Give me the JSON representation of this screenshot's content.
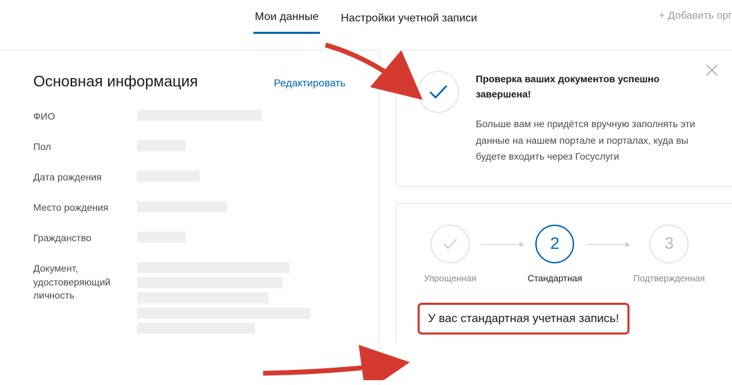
{
  "tabs": {
    "my_data": "Мои данные",
    "account_settings": "Настройки учетной записи",
    "add_org": "+ Добавить орг"
  },
  "basic_info": {
    "title": "Основная информация",
    "edit": "Редактировать",
    "fields": {
      "fio": "ФИО",
      "gender": "Пол",
      "birth_date": "Дата рождения",
      "birth_place": "Место рождения",
      "citizenship": "Гражданство",
      "id_document": "Документ, удостоверяющий личность"
    }
  },
  "notice": {
    "title": "Проверка ваших документов успешно завершена!",
    "description": "Больше вам не придётся вручную заполнять эти данные на нашем портале и порталах, куда вы будете входить через Госуслуги"
  },
  "account_status": {
    "steps": {
      "simplified": "Упрощенная",
      "standard": "Стандартная",
      "confirmed": "Подтвержденная",
      "step2_num": "2",
      "step3_num": "3"
    },
    "status_text": "У вас стандартная учетная запись!"
  }
}
